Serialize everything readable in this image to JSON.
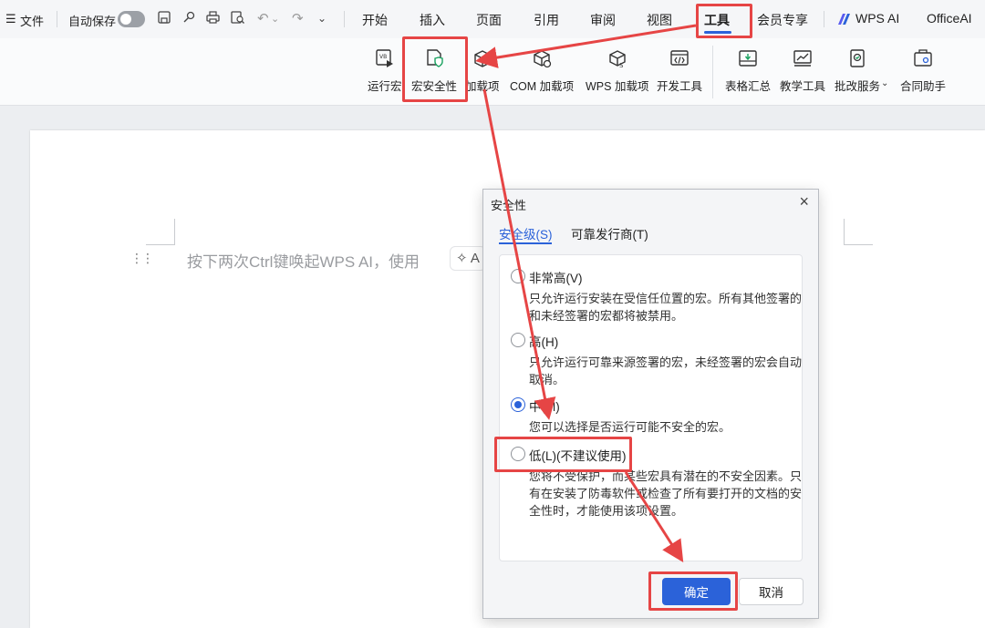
{
  "topbar": {
    "menu_icon": "menu-lines-icon",
    "file": "文件",
    "autosave": "自动保存",
    "tabs": [
      "开始",
      "插入",
      "页面",
      "引用",
      "审阅",
      "视图",
      "工具",
      "会员专享",
      "WPS AI",
      "OfficeAI"
    ],
    "active_tab": "工具"
  },
  "ribbon": {
    "items": [
      {
        "label": "运行宏",
        "icon": "run-macro-icon"
      },
      {
        "label": "宏安全性",
        "icon": "macro-security-icon"
      },
      {
        "label": "加载项",
        "icon": "addin-box-icon"
      },
      {
        "label": "COM 加载项",
        "icon": "com-addin-icon"
      },
      {
        "label": "WPS 加载项",
        "icon": "wps-addin-icon"
      },
      {
        "label": "开发工具",
        "icon": "developer-tools-icon"
      },
      {
        "label": "表格汇总",
        "icon": "table-summary-icon"
      },
      {
        "label": "教学工具",
        "icon": "teaching-tools-icon"
      },
      {
        "label": "批改服务",
        "icon": "grading-service-icon"
      },
      {
        "label": "合同助手",
        "icon": "contract-assistant-icon"
      }
    ]
  },
  "document": {
    "hint": "按下两次Ctrl键唤起WPS AI，使用",
    "chip": "A"
  },
  "dialog": {
    "title": "安全性",
    "close": "×",
    "tabs": [
      "安全级(S)",
      "可靠发行商(T)"
    ],
    "options": [
      {
        "label": "非常高(V)",
        "desc": "只允许运行安装在受信任位置的宏。所有其他签署的和未经签署的宏都将被禁用。",
        "checked": false
      },
      {
        "label": "高(H)",
        "desc": "只允许运行可靠来源签署的宏，未经签署的宏会自动取消。",
        "checked": false
      },
      {
        "label": "中(M)",
        "desc": "您可以选择是否运行可能不安全的宏。",
        "checked": true
      },
      {
        "label": "低(L)(不建议使用)",
        "desc": "您将不受保护，而某些宏具有潜在的不安全因素。只有在安装了防毒软件或检查了所有要打开的文档的安全性时，才能使用该项设置。",
        "checked": false
      }
    ],
    "ok": "确定",
    "cancel": "取消"
  },
  "colors": {
    "accent": "#2b62d9",
    "annotation": "#e64545"
  }
}
